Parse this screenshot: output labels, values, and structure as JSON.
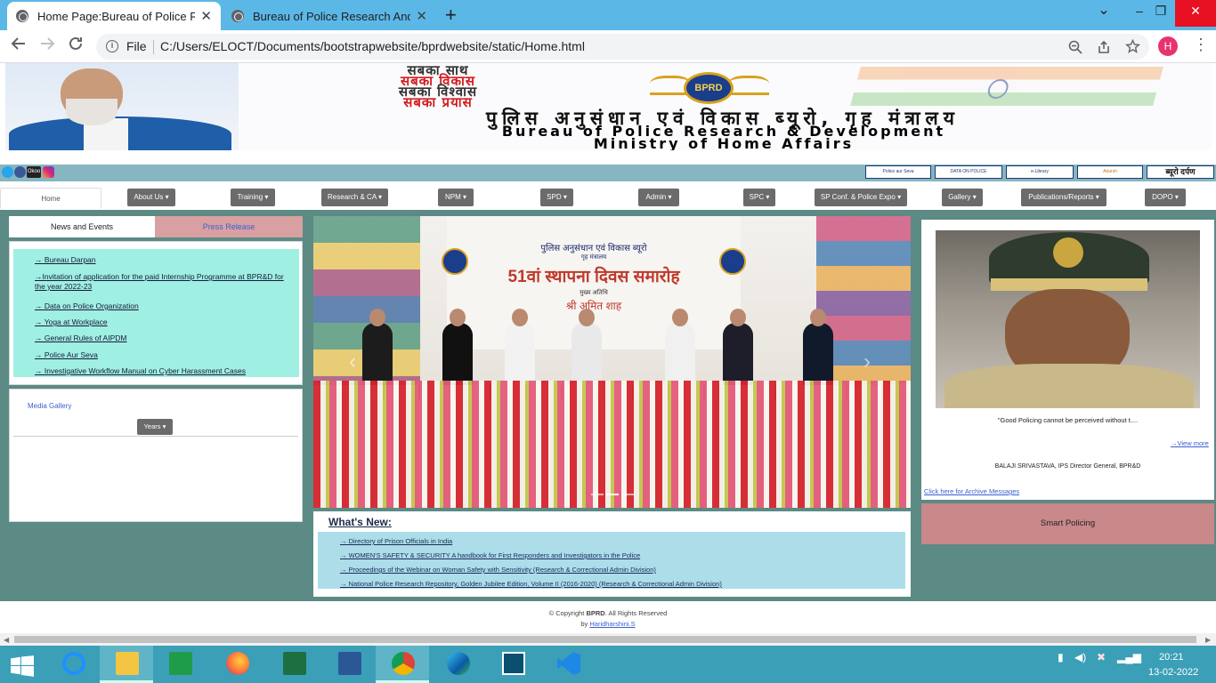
{
  "browser": {
    "tabs": [
      {
        "title": "Home Page:Bureau of Police Rese",
        "close": "✕"
      },
      {
        "title": "Bureau of Police Research And D",
        "close": "✕"
      }
    ],
    "new_tab": "+",
    "window_controls": {
      "dropdown": "⌄",
      "minimize": "–",
      "restore": "❐",
      "close": "✕"
    },
    "info_label": "File",
    "url": "C:/Users/ELOCT/Documents/bootstrapwebsite/bprdwebsite/static/Home.html",
    "avatar_letter": "H",
    "menu": "⋮"
  },
  "banner": {
    "slogan": [
      "सबका साथ",
      "सबका विकास",
      "सबका विश्वास",
      "सबका प्रयास"
    ],
    "emblem_text": "BPRD",
    "hindi_title": "पुलिस अनुसंधान एवं विकास ब्यूरो, गृह मंत्रालय",
    "english_line1": "Bureau of Police Research & Development",
    "english_line2": "Ministry of Home Affairs"
  },
  "strip": {
    "links": [
      "Police aur Seva",
      "DATA ON POLICE ORGANIZATION",
      "e-Library",
      "Adarsh",
      "ब्यूरो दर्पण"
    ]
  },
  "nav": {
    "home": "Home",
    "items": [
      "About Us",
      "Training",
      "Research & CA",
      "NPM",
      "SPD",
      "Admin",
      "SPC",
      "SP Conf. & Police Expo",
      "Gallery",
      "Publications/Reports",
      "DOPO"
    ],
    "caret": "▾"
  },
  "left": {
    "tab_news": "News and Events",
    "tab_press": "Press Release",
    "news": [
      "→ Bureau Darpan",
      "→Invitation of application for the paid Internship Programme at BPR&D for the year 2022-23",
      "→ Data on Police Organization",
      "→ Yoga at Workplace",
      "→ General Rules of AIPDM",
      "→ Police Aur Seva",
      "→ Investigative Workflow Manual on Cyber Harassment Cases"
    ],
    "media_gallery": "Media Gallery",
    "years": "Years"
  },
  "carousel": {
    "banner_hindi_top": "पुलिस अनुसंधान एवं विकास ब्यूरो",
    "banner_hindi_sub": "गृह मंत्रालय",
    "banner_title": "51वां स्थापना दिवस समारोह",
    "banner_guest_label": "मुख्य अतिथि",
    "banner_guest": "श्री अमित शाह",
    "prev": "‹",
    "next": "›"
  },
  "whats_new": {
    "title": "What's New:",
    "items": [
      "→ Directory of Prison Officials in India",
      "→ WOMEN'S SAFETY & SECURITY A handbook for First Responders and Investigators in the Police",
      "→ Proceedings of the Webinar on Woman Safety with Sensitivity (Research & Correctional Admin Division)",
      "→ National Police Research Repository, Golden Jubilee Edition, Volume II (2016-2020) (Research & Correctional Admin Division)"
    ]
  },
  "dg": {
    "quote": "\"Good Policing cannot be perceived without t....",
    "view_more": "→View more",
    "name": "BALAJI SRIVASTAVA, IPS Director General, BPR&D",
    "archive": "Click here for Archive Messages",
    "smart": "Smart Policing"
  },
  "footer": {
    "copyright_pre": "© Copyright ",
    "brand": "BPRD",
    "copyright_post": ". All Rights Reserved",
    "by": "by ",
    "author": "Haridharshini.S"
  },
  "taskbar": {
    "apps": [
      "start",
      "internet-explorer",
      "file-explorer",
      "excel-green",
      "firefox",
      "excel",
      "word",
      "chrome",
      "edge",
      "photos",
      "vscode"
    ],
    "time": "20:21",
    "date": "13-02-2022"
  },
  "colors": {
    "tabbar": "#5bb8e6",
    "main_bg": "#5c8a84",
    "news_bg": "#9fefe2",
    "press_tab": "#d9a0a2",
    "whats_new_bg": "#acdde9",
    "smart_bg": "#c9888a",
    "taskbar": "#3b9fb8"
  }
}
